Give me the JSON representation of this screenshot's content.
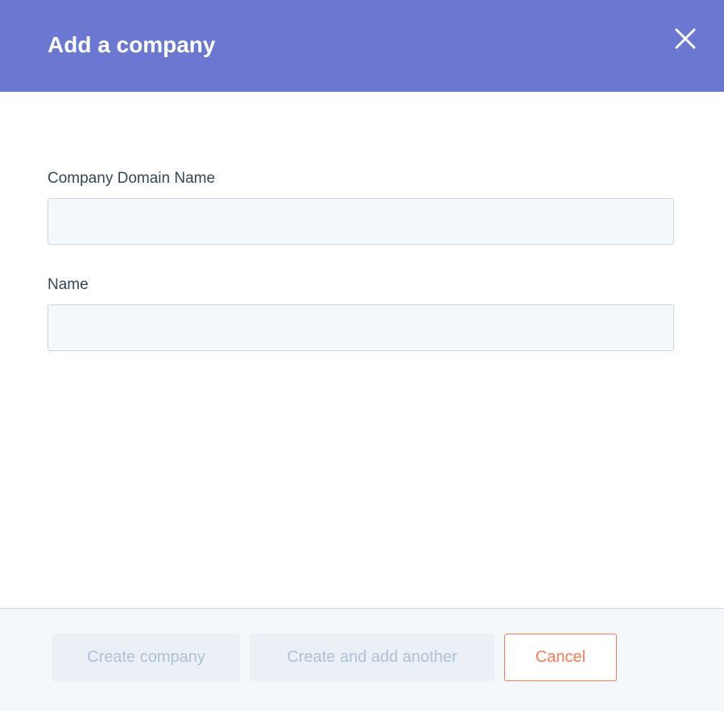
{
  "dialog": {
    "title": "Add a company",
    "close_icon": "close-icon"
  },
  "form": {
    "fields": [
      {
        "label": "Company Domain Name",
        "value": "",
        "placeholder": ""
      },
      {
        "label": "Name",
        "value": "",
        "placeholder": ""
      }
    ]
  },
  "footer": {
    "create_label": "Create company",
    "create_another_label": "Create and add another",
    "cancel_label": "Cancel"
  },
  "colors": {
    "header_bg": "#6a78d1",
    "label_text": "#33475b",
    "input_bg": "#f5f8fa",
    "input_border": "#cbd6e2",
    "cancel_accent": "#ff7a59",
    "disabled_bg": "#eaf0f6",
    "disabled_text": "#b0c1d4"
  }
}
